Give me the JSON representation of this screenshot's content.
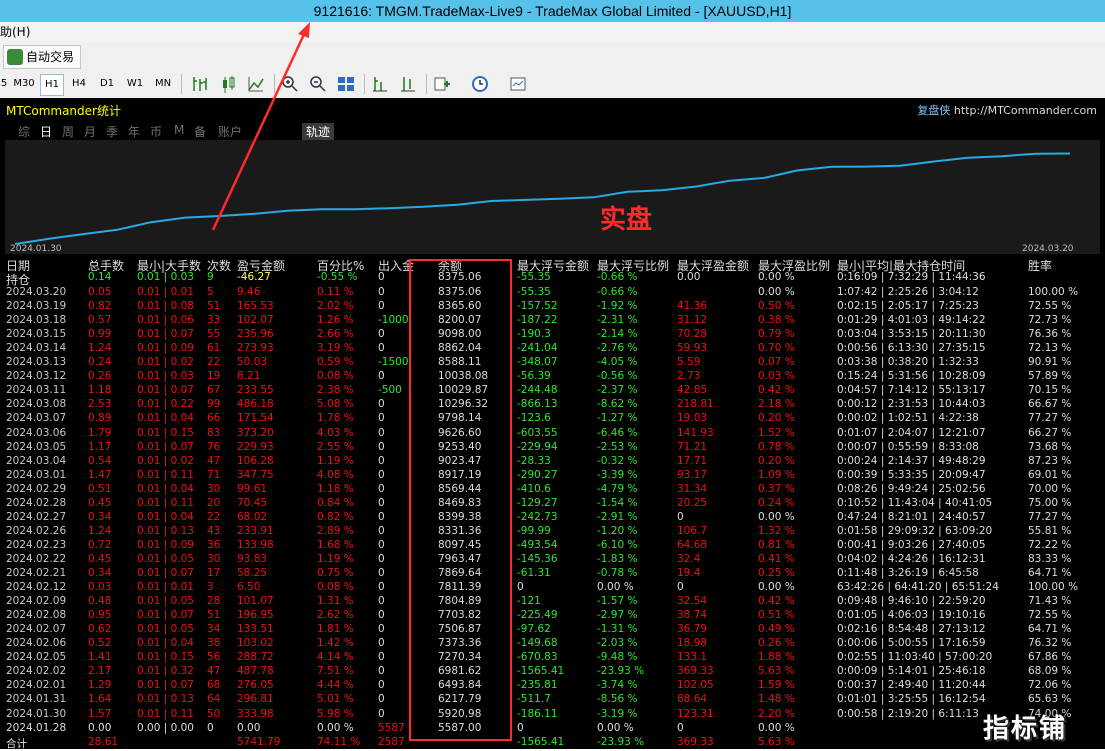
{
  "window": {
    "title": "9121616: TMGM.TradeMax-Live9 - TradeMax Global Limited - [XAUUSD,H1]"
  },
  "menu": {
    "help": "助(H)"
  },
  "toolbar": {
    "autotrade_label": "自动交易"
  },
  "timeframes": [
    "5",
    "M30",
    "H1",
    "H4",
    "D1",
    "W1",
    "MN"
  ],
  "active_timeframe": "H1",
  "panel": {
    "title": "MTCommander统计",
    "site_cn": "复盘侠",
    "site_url": "http://MTCommander.com",
    "tabs": [
      "综",
      "日",
      "周",
      "月",
      "季",
      "年",
      "币",
      "M",
      "备",
      "账户"
    ],
    "selected_tab": "日",
    "trace_tab": "轨迹",
    "start_date": "2024.01.30",
    "end_date": "2024.03.20",
    "overlay_label": "实盘",
    "watermark": "指标铺"
  },
  "colors": {
    "curve": "#29a9e6",
    "positive": "#2ee62e",
    "negative": "#ee1111",
    "highlight": "#ff2a2a"
  },
  "headers": [
    "日期",
    "总手数",
    "最小|大手数",
    "次数",
    "盈亏金额",
    "百分比%",
    "出入金",
    "余额",
    "最大浮亏金额",
    "最大浮亏比例",
    "最大浮盈金额",
    "最大浮盈比例",
    "最小|平均|最大持仓时间",
    "胜率"
  ],
  "position_row": {
    "label": "持仓",
    "lots": "0.14",
    "minmax": "0.01 | 0.03",
    "count": "9",
    "pnl": "-46.27",
    "pct": "-0.55 %",
    "inout": "0",
    "balance": "8375.06",
    "mdd_amt": "-55.35",
    "mdd_pct": "-0.66 %",
    "mfe_amt": "0.00",
    "mfe_pct": "0.00 %",
    "hold": "0:16:09 | 7:32:29 | 11:44:36",
    "win": ""
  },
  "rows": [
    [
      "2024.03.20",
      "0.05",
      "0.01 | 0.01",
      "5",
      "9.46",
      "0.11 %",
      "0",
      "8375.06",
      "-55.35",
      "-0.66 %",
      "",
      "0.00 %",
      "1:07:42 | 2:25:26 | 3:04:12",
      "100.00 %"
    ],
    [
      "2024.03.19",
      "0.82",
      "0.01 | 0.08",
      "51",
      "165.53",
      "2.02 %",
      "0",
      "8365.60",
      "-157.52",
      "-1.92 %",
      "41.36",
      "0.50 %",
      "0:02:15 | 2:05:17 | 7:25:23",
      "72.55 %"
    ],
    [
      "2024.03.18",
      "0.57",
      "0.01 | 0.06",
      "33",
      "102.07",
      "1.26 %",
      "-1000",
      "8200.07",
      "-187.22",
      "-2.31 %",
      "31.12",
      "0.38 %",
      "0:01:29 | 4:01:03 | 49:14:22",
      "72.73 %"
    ],
    [
      "2024.03.15",
      "0.99",
      "0.01 | 0.07",
      "55",
      "235.96",
      "2.66 %",
      "0",
      "9098.00",
      "-190.3",
      "-2.14 %",
      "70.28",
      "0.79 %",
      "0:03:04 | 3:53:15 | 20:11:30",
      "76.36 %"
    ],
    [
      "2024.03.14",
      "1.24",
      "0.01 | 0.09",
      "61",
      "273.93",
      "3.19 %",
      "0",
      "8862.04",
      "-241.04",
      "-2.76 %",
      "59.93",
      "0.70 %",
      "0:00:56 | 6:13:30 | 27:35:15",
      "72.13 %"
    ],
    [
      "2024.03.13",
      "0.24",
      "0.01 | 0.02",
      "22",
      "50.03",
      "0.59 %",
      "-1500",
      "8588.11",
      "-348.07",
      "-4.05 %",
      "5.59",
      "0.07 %",
      "0:03:38 | 0:38:20 | 1:32:33",
      "90.91 %"
    ],
    [
      "2024.03.12",
      "0.26",
      "0.01 | 0.03",
      "19",
      "8.21",
      "0.08 %",
      "0",
      "10038.08",
      "-56.39",
      "-0.56 %",
      "2.73",
      "0.03 %",
      "0:15:24 | 5:31:56 | 10:28:09",
      "57.89 %"
    ],
    [
      "2024.03.11",
      "1.18",
      "0.01 | 0.07",
      "67",
      "233.55",
      "2.38 %",
      "-500",
      "10029.87",
      "-244.48",
      "-2.37 %",
      "42.85",
      "0.42 %",
      "0:04:57 | 7:14:12 | 55:13:17",
      "70.15 %"
    ],
    [
      "2024.03.08",
      "2.53",
      "0.01 | 0.22",
      "99",
      "486.18",
      "5.08 %",
      "0",
      "10296.32",
      "-866.13",
      "-8.62 %",
      "218.81",
      "2.18 %",
      "0:00:12 | 2:31:53 | 10:44:03",
      "66.67 %"
    ],
    [
      "2024.03.07",
      "0.89",
      "0.01 | 0.04",
      "66",
      "171.54",
      "1.78 %",
      "0",
      "9798.14",
      "-123.6",
      "-1.27 %",
      "19.03",
      "0.20 %",
      "0:00:02 | 1:02:51 | 4:22:38",
      "77.27 %"
    ],
    [
      "2024.03.06",
      "1.79",
      "0.01 | 0.15",
      "83",
      "373.20",
      "4.03 %",
      "0",
      "9626.60",
      "-603.55",
      "-6.46 %",
      "141.93",
      "1.52 %",
      "0:01:07 | 2:04:07 | 12:21:07",
      "66.27 %"
    ],
    [
      "2024.03.05",
      "1.17",
      "0.01 | 0.07",
      "76",
      "229.93",
      "2.55 %",
      "0",
      "9253.40",
      "-229.94",
      "-2.53 %",
      "71.21",
      "0.78 %",
      "0:00:07 | 0:55:59 | 8:33:08",
      "73.68 %"
    ],
    [
      "2024.03.04",
      "0.54",
      "0.01 | 0.02",
      "47",
      "106.28",
      "1.19 %",
      "0",
      "9023.47",
      "-28.33",
      "-0.32 %",
      "17.71",
      "0.20 %",
      "0:00:24 | 2:14:37 | 49:48:29",
      "87.23 %"
    ],
    [
      "2024.03.01",
      "1.47",
      "0.01 | 0.11",
      "71",
      "347.75",
      "4.08 %",
      "0",
      "8917.19",
      "-290.27",
      "-3.39 %",
      "93.17",
      "1.09 %",
      "0:00:39 | 5:33:35 | 20:09:47",
      "69.01 %"
    ],
    [
      "2024.02.29",
      "0.51",
      "0.01 | 0.04",
      "30",
      "99.61",
      "1.18 %",
      "0",
      "8569.44",
      "-410.6",
      "-4.79 %",
      "31.34",
      "0.37 %",
      "0:08:26 | 9:49:24 | 25:02:56",
      "70.00 %"
    ],
    [
      "2024.02.28",
      "0.45",
      "0.01 | 0.11",
      "20",
      "70.45",
      "0.84 %",
      "0",
      "8469.83",
      "-129.27",
      "-1.54 %",
      "20.25",
      "0.24 %",
      "0:10:52 | 11:43:04 | 40:41:05",
      "75.00 %"
    ],
    [
      "2024.02.27",
      "0.34",
      "0.01 | 0.04",
      "22",
      "68.02",
      "0.82 %",
      "0",
      "8399.38",
      "-242.73",
      "-2.91 %",
      "0",
      "0.00 %",
      "0:47:24 | 8:21:01 | 24:40:57",
      "77.27 %"
    ],
    [
      "2024.02.26",
      "1.24",
      "0.01 | 0.13",
      "43",
      "233.91",
      "2.89 %",
      "0",
      "8331.36",
      "-99.99",
      "-1.20 %",
      "106.7",
      "1.32 %",
      "0:01:58 | 29:09:32 | 63:09:20",
      "55.81 %"
    ],
    [
      "2024.02.23",
      "0.72",
      "0.01 | 0.09",
      "36",
      "133.98",
      "1.68 %",
      "0",
      "8097.45",
      "-493.54",
      "-6.10 %",
      "64.68",
      "0.81 %",
      "0:00:41 | 9:03:26 | 27:40:05",
      "72.22 %"
    ],
    [
      "2024.02.22",
      "0.45",
      "0.01 | 0.05",
      "30",
      "93.83",
      "1.19 %",
      "0",
      "7963.47",
      "-145.36",
      "-1.83 %",
      "32.4",
      "0.41 %",
      "0:04:02 | 4:24:26 | 16:12:31",
      "83.33 %"
    ],
    [
      "2024.02.21",
      "0.34",
      "0.01 | 0.07",
      "17",
      "58.25",
      "0.75 %",
      "0",
      "7869.64",
      "-61.31",
      "-0.78 %",
      "19.4",
      "0.25 %",
      "0:11:48 | 3:26:19 | 6:45:58",
      "64.71 %"
    ],
    [
      "2024.02.12",
      "0.03",
      "0.01 | 0.01",
      "3",
      "6.50",
      "0.08 %",
      "0",
      "7811.39",
      "0",
      "0.00 %",
      "0",
      "0.00 %",
      "63:42:26 | 64:41:20 | 65:51:24",
      "100.00 %"
    ],
    [
      "2024.02.09",
      "0.48",
      "0.01 | 0.05",
      "28",
      "101.07",
      "1.31 %",
      "0",
      "7804.89",
      "-121",
      "-1.57 %",
      "32.54",
      "0.42 %",
      "0:09:48 | 9:46:10 | 22:59:20",
      "71.43 %"
    ],
    [
      "2024.02.08",
      "0.95",
      "0.01 | 0.07",
      "51",
      "196.95",
      "2.62 %",
      "0",
      "7703.82",
      "-225.49",
      "-2.97 %",
      "38.74",
      "0.51 %",
      "0:01:05 | 4:06:03 | 19:10:16",
      "72.55 %"
    ],
    [
      "2024.02.07",
      "0.62",
      "0.01 | 0.05",
      "34",
      "133.51",
      "1.81 %",
      "0",
      "7506.87",
      "-97.62",
      "-1.31 %",
      "36.79",
      "0.49 %",
      "0:02:16 | 8:54:48 | 27:13:12",
      "64.71 %"
    ],
    [
      "2024.02.06",
      "0.52",
      "0.01 | 0.04",
      "38",
      "103.02",
      "1.42 %",
      "0",
      "7373.36",
      "-149.68",
      "-2.03 %",
      "18.98",
      "0.26 %",
      "0:00:06 | 5:00:55 | 17:16:59",
      "76.32 %"
    ],
    [
      "2024.02.05",
      "1.41",
      "0.01 | 0.15",
      "56",
      "288.72",
      "4.14 %",
      "0",
      "7270.34",
      "-670.83",
      "-9.48 %",
      "133.1",
      "1.88 %",
      "0:02:55 | 11:03:40 | 57:00:20",
      "67.86 %"
    ],
    [
      "2024.02.02",
      "2.17",
      "0.01 | 0.32",
      "47",
      "487.78",
      "7.51 %",
      "0",
      "6981.62",
      "-1565.41",
      "-23.93 %",
      "369.33",
      "5.63 %",
      "0:00:09 | 5:14:01 | 25:46:18",
      "68.09 %"
    ],
    [
      "2024.02.01",
      "1.29",
      "0.01 | 0.07",
      "68",
      "276.05",
      "4.44 %",
      "0",
      "6493.84",
      "-235.81",
      "-3.74 %",
      "102.05",
      "1.59 %",
      "0:00:37 | 2:49:40 | 11:20:44",
      "72.06 %"
    ],
    [
      "2024.01.31",
      "1.64",
      "0.01 | 0.13",
      "64",
      "296.81",
      "5.01 %",
      "0",
      "6217.79",
      "-511.7",
      "-8.56 %",
      "88.64",
      "1.48 %",
      "0:01:01 | 3:25:55 | 16:12:54",
      "65.63 %"
    ],
    [
      "2024.01.30",
      "1.57",
      "0.01 | 0.11",
      "50",
      "333.98",
      "5.98 %",
      "0",
      "5920.98",
      "-186.11",
      "-3.19 %",
      "123.31",
      "2.20 %",
      "0:00:58 | 2:19:20 | 6:11:13",
      "74.00 %"
    ],
    [
      "2024.01.28",
      "0.00",
      "0.00 | 0.00",
      "0",
      "0.00",
      "0.00 %",
      "5587",
      "5587.00",
      "0",
      "0.00 %",
      "0",
      "0.00 %",
      "",
      ""
    ]
  ],
  "total_row": {
    "label": "合计",
    "lots": "28.61",
    "pnl": "5741.79",
    "pct": "74.11 %",
    "inout": "2587",
    "mdd_amt": "-1565.41",
    "mdd_pct": "-23.93 %",
    "mfe_amt": "369.33",
    "mfe_pct": "5.63 %"
  },
  "chart_data": {
    "type": "line",
    "x_start": "2024.01.30",
    "x_end": "2024.03.20",
    "x": [
      "2024.01.28",
      "2024.01.30",
      "2024.01.31",
      "2024.02.01",
      "2024.02.02",
      "2024.02.05",
      "2024.02.06",
      "2024.02.07",
      "2024.02.08",
      "2024.02.09",
      "2024.02.12",
      "2024.02.21",
      "2024.02.22",
      "2024.02.23",
      "2024.02.26",
      "2024.02.27",
      "2024.02.28",
      "2024.02.29",
      "2024.03.01",
      "2024.03.04",
      "2024.03.05",
      "2024.03.06",
      "2024.03.07",
      "2024.03.08",
      "2024.03.11",
      "2024.03.12",
      "2024.03.13",
      "2024.03.14",
      "2024.03.15",
      "2024.03.18",
      "2024.03.19",
      "2024.03.20"
    ],
    "series": [
      {
        "values": [
          0,
          333.98,
          630.79,
          906.84,
          1394.62,
          1683.34,
          1786.36,
          1919.87,
          2116.82,
          2217.89,
          2224.39,
          2282.64,
          2376.47,
          2510.45,
          2744.36,
          2812.38,
          2882.83,
          2982.44,
          3330.19,
          3436.47,
          3666.4,
          4039.6,
          4211.14,
          4697.32,
          4930.87,
          4939.08,
          4989.11,
          5263.04,
          5499.0,
          5601.07,
          5766.6,
          5776.06
        ]
      }
    ],
    "ylim": [
      0,
      6000
    ],
    "grid": false
  }
}
